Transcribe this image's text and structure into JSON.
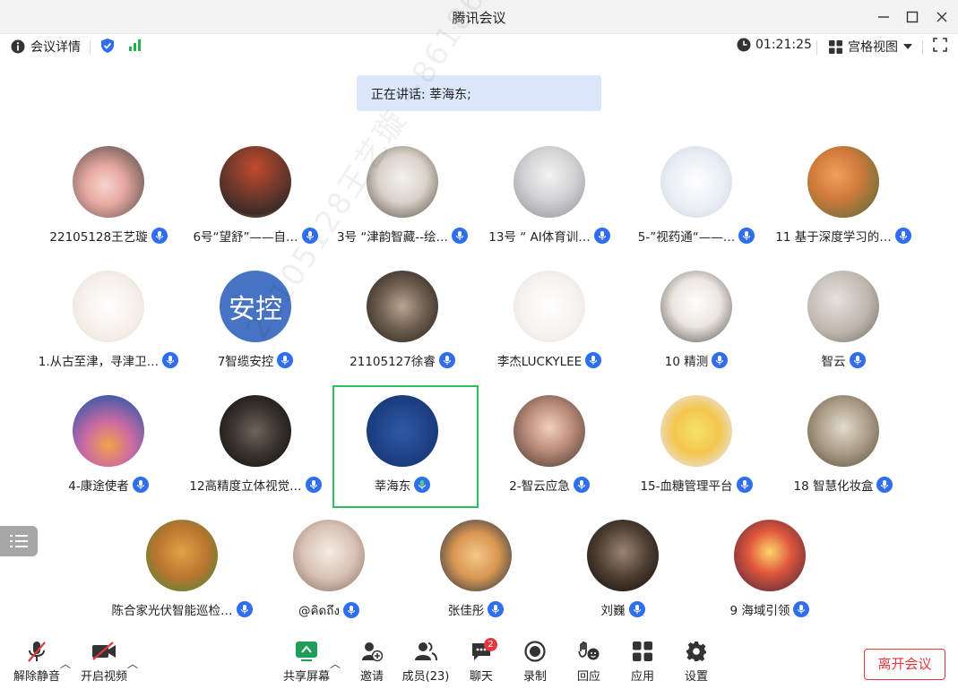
{
  "window": {
    "title": "腾讯会议"
  },
  "infobar": {
    "meeting_details": "会议详情",
    "timer": "01:21:25",
    "view_mode": "宫格视图"
  },
  "speaking": {
    "text": "正在讲话: 莘海东;"
  },
  "watermark": {
    "text": "22105128王艺璇 +8618633250081"
  },
  "participants": [
    {
      "name": "22105128王艺璇"
    },
    {
      "name": "6号“望舒”——自…"
    },
    {
      "name": "3号 “津韵智藏--绘…"
    },
    {
      "name": "13号 “ AI体育训…"
    },
    {
      "name": "5-”视药通“——…"
    },
    {
      "name": "11 基于深度学习的…"
    },
    {
      "name": "1.从古至津，寻津卫…"
    },
    {
      "name": "7智缆安控",
      "avatar_text": "安控"
    },
    {
      "name": "21105127徐睿"
    },
    {
      "name": "李杰LUCKYLEE"
    },
    {
      "name": "10 精测"
    },
    {
      "name": "智云"
    },
    {
      "name": "4-康途使者"
    },
    {
      "name": "12高精度立体视觉…"
    },
    {
      "name": "莘海东"
    },
    {
      "name": "2-智云应急"
    },
    {
      "name": "15-血糖管理平台"
    },
    {
      "name": "18 智慧化妆盒"
    },
    {
      "name": "陈合家光伏智能巡检…"
    },
    {
      "name": "@คิดถึง"
    },
    {
      "name": "张佳彤"
    },
    {
      "name": "刘巍"
    },
    {
      "name": "9 海域引领"
    }
  ],
  "toolbar": {
    "unmute": "解除静音",
    "video": "开启视频",
    "share": "共享屏幕",
    "invite": "邀请",
    "members": "成员(23)",
    "chat": "聊天",
    "chat_badge": "2",
    "record": "录制",
    "react": "回应",
    "apps": "应用",
    "settings": "设置",
    "leave": "离开会议"
  },
  "colors": {
    "accent": "#2f6fef",
    "leave": "#e0383e",
    "selected": "#2ebe62",
    "speaking_bg": "#dbe8fb"
  }
}
